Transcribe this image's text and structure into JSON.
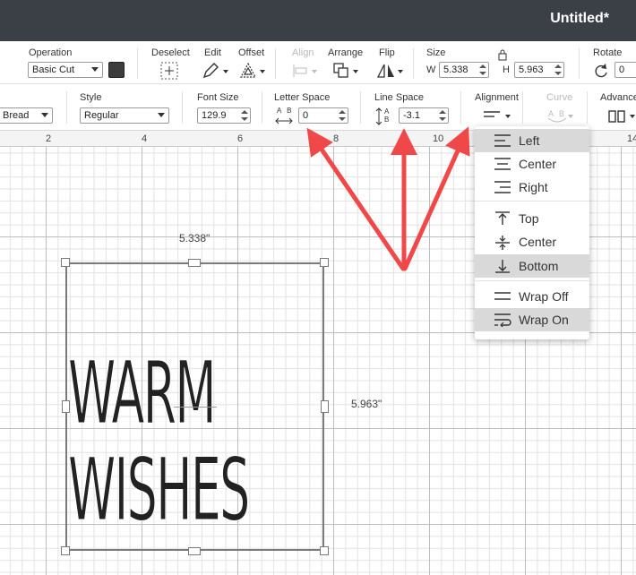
{
  "window": {
    "title": "Untitled*"
  },
  "toolbar1": {
    "operation": {
      "label": "Operation",
      "value": "Basic Cut"
    },
    "deselect": "Deselect",
    "edit": "Edit",
    "offset": "Offset",
    "align": "Align",
    "arrange": "Arrange",
    "flip": "Flip",
    "size": {
      "label": "Size",
      "w_label": "W",
      "w": "5.338",
      "h_label": "H",
      "h": "5.963"
    },
    "rotate": {
      "label": "Rotate",
      "value": "0"
    }
  },
  "toolbar2": {
    "font": {
      "value": "Bread"
    },
    "style": {
      "label": "Style",
      "value": "Regular"
    },
    "font_size": {
      "label": "Font Size",
      "value": "129.9"
    },
    "letter_space": {
      "label": "Letter Space",
      "value": "0",
      "icon_text": "A B"
    },
    "line_space": {
      "label": "Line Space",
      "value": "-3.1",
      "icon_text": "A B"
    },
    "alignment": {
      "label": "Alignment"
    },
    "curve": {
      "label": "Curve",
      "icon_text": "A B"
    },
    "advanced": {
      "label": "Advance"
    }
  },
  "ruler": {
    "ticks": [
      "2",
      "4",
      "6",
      "8",
      "10",
      "14"
    ]
  },
  "canvas": {
    "width_label": "5.338\"",
    "height_label": "5.963\"",
    "text_line1": "WARM",
    "text_line2": "WISHES"
  },
  "alignment_menu": {
    "items": [
      {
        "label": "Left",
        "icon": "align-left-icon",
        "active": true
      },
      {
        "label": "Center",
        "icon": "align-center-icon",
        "active": false
      },
      {
        "label": "Right",
        "icon": "align-right-icon",
        "active": false
      },
      {
        "label": "Top",
        "icon": "align-top-icon",
        "active": false
      },
      {
        "label": "Center",
        "icon": "align-middle-icon",
        "active": false
      },
      {
        "label": "Bottom",
        "icon": "align-bottom-icon",
        "active": true
      },
      {
        "label": "Wrap Off",
        "icon": "wrap-off-icon",
        "active": false
      },
      {
        "label": "Wrap On",
        "icon": "wrap-on-icon",
        "active": true
      }
    ]
  },
  "colors": {
    "titlebar": "#3b4047",
    "arrow": "#f04848",
    "swatch": "#3d3d3d"
  }
}
